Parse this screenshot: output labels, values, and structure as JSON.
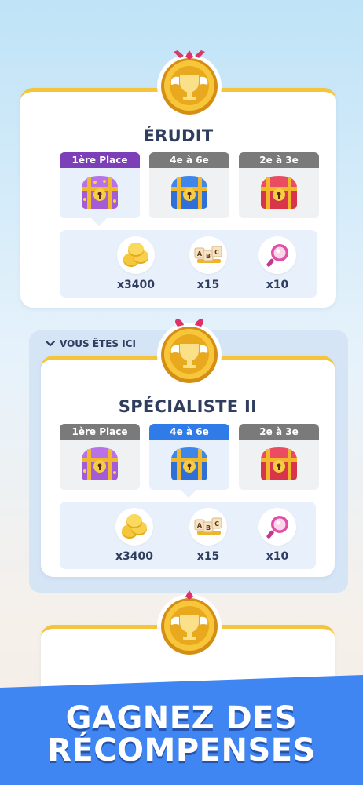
{
  "tiers": [
    {
      "title": "ÉRUDIT",
      "places": [
        "1ère Place",
        "4e à 6e",
        "2e à 3e"
      ],
      "rewards": [
        "x3400",
        "x15",
        "x10"
      ]
    },
    {
      "you_are_here": "VOUS ÊTES ICI",
      "title": "SPÉCIALISTE II",
      "places": [
        "1ère Place",
        "4e à 6e",
        "2e à 3e"
      ],
      "rewards": [
        "x3400",
        "x15",
        "x10"
      ]
    }
  ],
  "banner": {
    "line1": "GAGNEZ DES",
    "line2": "RÉCOMPENSES"
  },
  "colors": {
    "gold": "#f4c53a",
    "purple_tab": "#7c3fb8",
    "blue_tab": "#2f7be8",
    "grey_tab": "#7a7a7a",
    "banner_blue": "#3f86f2"
  }
}
